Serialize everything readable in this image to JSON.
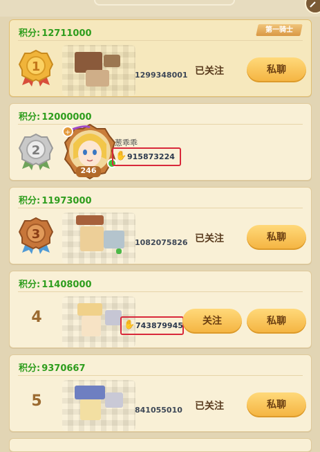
{
  "labels": {
    "score_prefix": "积分:",
    "followed": "已关注",
    "follow": "关注",
    "private_chat": "私聊"
  },
  "entries": [
    {
      "rank": "1",
      "score": "12711000",
      "uid": "1299348001",
      "title_badge": "第一骑士",
      "followed": true
    },
    {
      "rank": "2",
      "score": "12000000",
      "uid": "915873224",
      "name": "葱乖乖",
      "level": "246",
      "followed": false
    },
    {
      "rank": "3",
      "score": "11973000",
      "uid": "1082075826",
      "followed": true
    },
    {
      "rank": "4",
      "score": "11408000",
      "uid": "743879945",
      "followed": false
    },
    {
      "rank": "5",
      "score": "9370667",
      "uid": "841055010",
      "followed": true
    }
  ],
  "colors": {
    "score_green": "#2e9d1d",
    "button_gold": "#f4b340",
    "card_bg": "#f9f0d6",
    "highlight_red": "#d8283a"
  },
  "icons": {
    "medal_1": "gold-medal",
    "medal_2": "silver-medal",
    "medal_3": "bronze-medal",
    "uid_hand": "hand-icon"
  }
}
